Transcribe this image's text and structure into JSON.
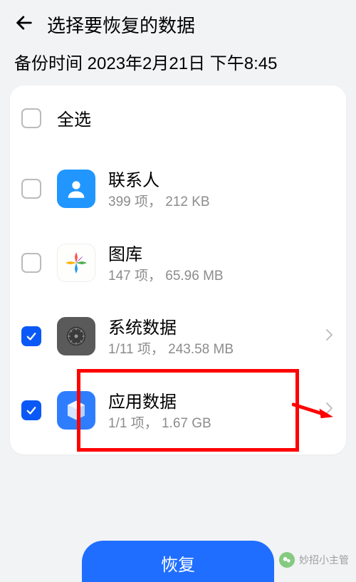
{
  "header": {
    "title": "选择要恢复的数据"
  },
  "backup_time_label": "备份时间 2023年2月21日 下午8:45",
  "select_all_label": "全选",
  "items": [
    {
      "title": "联系人",
      "sub": "399 项， 212 KB",
      "checked": false,
      "has_chevron": false
    },
    {
      "title": "图库",
      "sub": "147 项， 65.96 MB",
      "checked": false,
      "has_chevron": false
    },
    {
      "title": "系统数据",
      "sub": "1/11 项， 243.58 MB",
      "checked": true,
      "has_chevron": true
    },
    {
      "title": "应用数据",
      "sub": "1/1 项， 1.67 GB",
      "checked": true,
      "has_chevron": true
    }
  ],
  "restore_button": "恢复",
  "watermark_text": "妙招小主管"
}
